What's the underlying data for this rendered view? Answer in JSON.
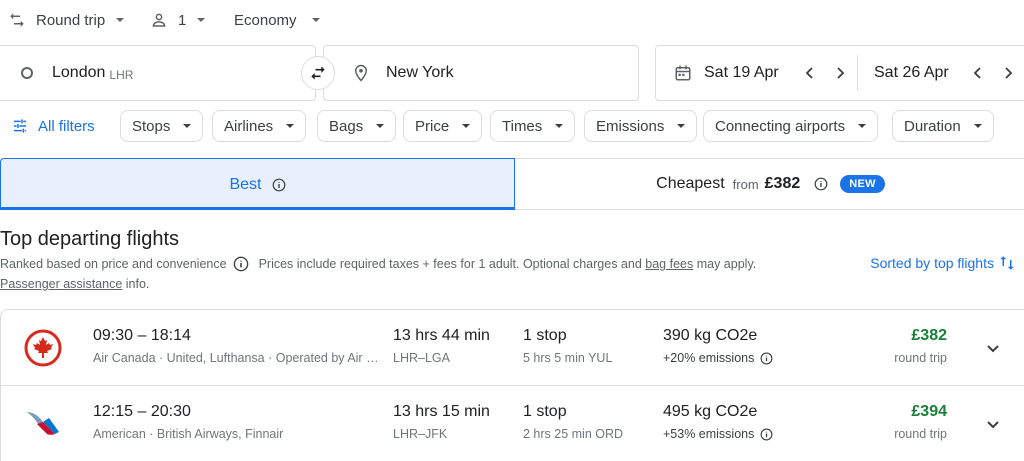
{
  "options": {
    "trip_type": "Round trip",
    "passengers": "1",
    "cabin": "Economy"
  },
  "search": {
    "origin_city": "London",
    "origin_code": "LHR",
    "destination": "New York",
    "depart_date": "Sat 19 Apr",
    "return_date": "Sat 26 Apr"
  },
  "filters": {
    "all_label": "All filters",
    "chips": [
      "Stops",
      "Airlines",
      "Bags",
      "Price",
      "Times",
      "Emissions",
      "Connecting airports",
      "Duration"
    ]
  },
  "tabs": {
    "best": "Best",
    "cheapest": "Cheapest",
    "cheapest_from": "from",
    "cheapest_price": "£382",
    "new_badge": "NEW"
  },
  "section": {
    "title": "Top departing flights",
    "ranked": "Ranked based on price and convenience",
    "prices_note": "Prices include required taxes + fees for 1 adult. Optional charges and",
    "bag_fees": "bag fees",
    "may_apply": "may apply.",
    "passenger_assistance": "Passenger assistance",
    "info_suffix": "info.",
    "sorted_label": "Sorted by top flights"
  },
  "flights": [
    {
      "airline_logo": "air-canada-maple-leaf",
      "times": "09:30 – 18:14",
      "carriers": "Air Canada · United, Lufthansa · Operated by Air Canada Rouge",
      "duration": "13 hrs 44 min",
      "route": "LHR–LGA",
      "stops": "1 stop",
      "layover": "5 hrs 5 min YUL",
      "co2": "390 kg CO2e",
      "emissions": "+20% emissions",
      "price": "£382",
      "price_type": "round trip"
    },
    {
      "airline_logo": "american-airlines-eagle",
      "times": "12:15 – 20:30",
      "carriers": "American · British Airways, Finnair",
      "duration": "13 hrs 15 min",
      "route": "LHR–JFK",
      "stops": "1 stop",
      "layover": "2 hrs 25 min ORD",
      "co2": "495 kg CO2e",
      "emissions": "+53% emissions",
      "price": "£394",
      "price_type": "round trip"
    }
  ],
  "colors": {
    "accent": "#1a73e8",
    "price_green": "#188038",
    "air_canada_red": "#d52b1e"
  }
}
